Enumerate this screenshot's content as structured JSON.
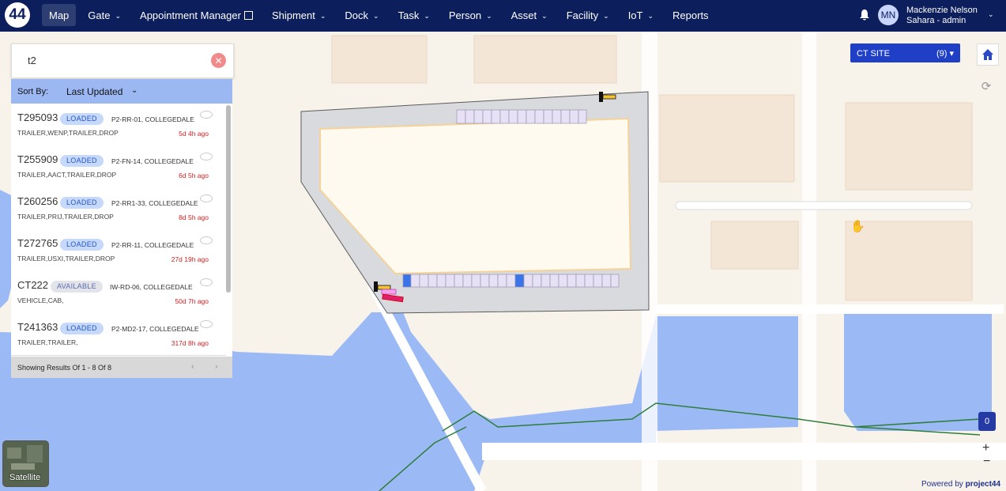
{
  "nav": {
    "logo": "44",
    "items": [
      {
        "label": "Map"
      },
      {
        "label": "Gate"
      },
      {
        "label": "Appointment Manager"
      },
      {
        "label": "Shipment"
      },
      {
        "label": "Dock"
      },
      {
        "label": "Task"
      },
      {
        "label": "Person"
      },
      {
        "label": "Asset"
      },
      {
        "label": "Facility"
      },
      {
        "label": "IoT"
      },
      {
        "label": "Reports"
      }
    ],
    "user": {
      "initials": "MN",
      "name": "Mackenzie Nelson",
      "role": "Sahara - admin"
    }
  },
  "search": {
    "value": "t2",
    "clear_icon": "close-icon"
  },
  "sort": {
    "label": "Sort By:",
    "value": "Last Updated"
  },
  "results": [
    {
      "id": "T295093",
      "status": "LOADED",
      "location": "P2-RR-01, COLLEGEDALE",
      "tags": "TRAILER,WENP,TRAILER,DROP",
      "ago": "5d 4h ago"
    },
    {
      "id": "T255909",
      "status": "LOADED",
      "location": "P2-FN-14, COLLEGEDALE",
      "tags": "TRAILER,AACT,TRAILER,DROP",
      "ago": "6d 5h ago"
    },
    {
      "id": "T260256",
      "status": "LOADED",
      "location": "P2-RR1-33, COLLEGEDALE",
      "tags": "TRAILER,PRIJ,TRAILER,DROP",
      "ago": "8d 5h ago"
    },
    {
      "id": "T272765",
      "status": "LOADED",
      "location": "P2-RR-11, COLLEGEDALE",
      "tags": "TRAILER,USXI,TRAILER,DROP",
      "ago": "27d 19h ago"
    },
    {
      "id": "CT222",
      "status": "AVAILABLE",
      "location": "IW-RD-06, COLLEGEDALE",
      "tags": "VEHICLE,CAB,",
      "ago": "50d 7h ago"
    },
    {
      "id": "T241363",
      "status": "LOADED",
      "location": "P2-MD2-17, COLLEGEDALE",
      "tags": "TRAILER,TRAILER,",
      "ago": "317d 8h ago"
    }
  ],
  "footer": {
    "text": "Showing Results Of 1 - 8 Of 8"
  },
  "site": {
    "name": "CT SITE",
    "count": "(9)"
  },
  "map_controls": {
    "zero_count": "0",
    "zoom_in": "+",
    "zoom_out": "−",
    "satellite_label": "Satellite"
  },
  "powered": {
    "prefix": "Powered by",
    "brand": "project44"
  },
  "colors": {
    "nav_bg": "#0c1f5c",
    "accent": "#1f3fc6",
    "water": "#9bb9f5",
    "overdue": "#d42020"
  }
}
